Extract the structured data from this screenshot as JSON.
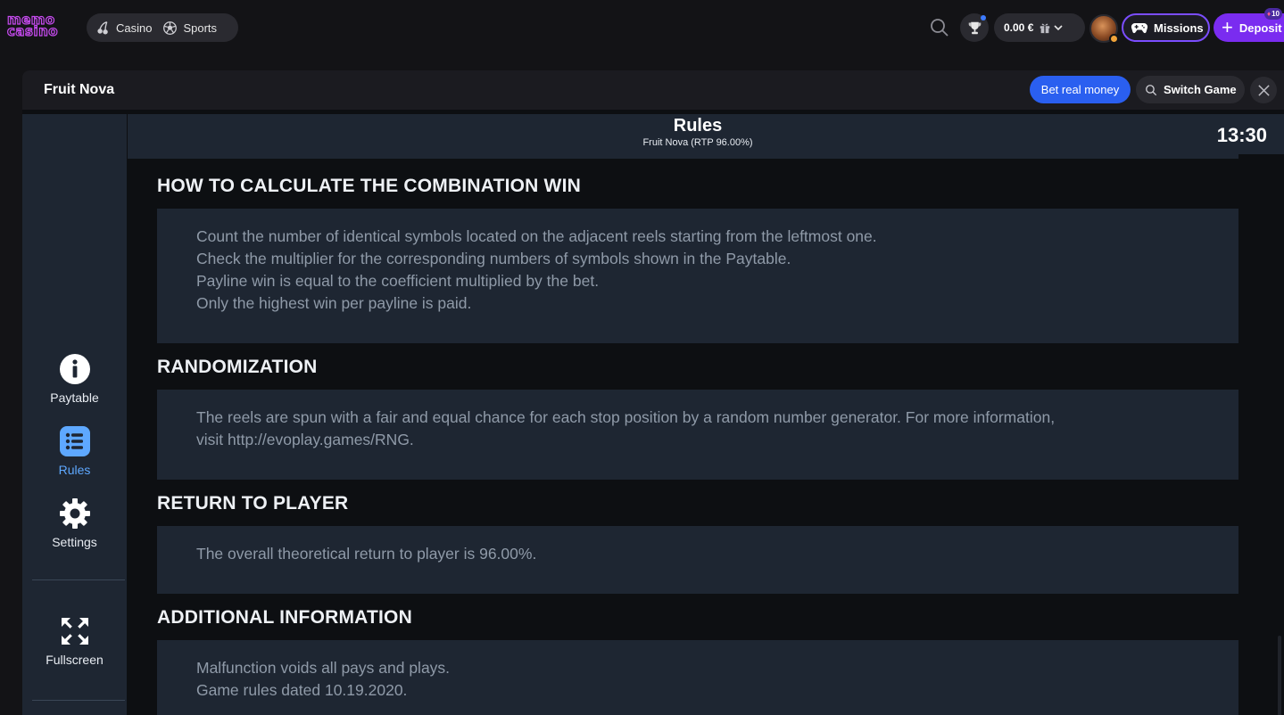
{
  "topbar": {
    "logo_line1": "memo",
    "logo_line2": "casino",
    "nav": [
      {
        "label": "Casino",
        "icon": "cherries-icon"
      },
      {
        "label": "Sports",
        "icon": "soccer-ball-icon"
      }
    ],
    "balance": "0.00 €",
    "missions_label": "Missions",
    "deposit_label": "Deposit",
    "deposit_badge": "10",
    "accent": "#7a2cf0"
  },
  "game": {
    "title": "Fruit Nova",
    "bet_real_label": "Bet real money",
    "switch_game_label": "Switch Game"
  },
  "side_menu": {
    "items": [
      {
        "label": "Paytable",
        "icon": "info-icon"
      },
      {
        "label": "Rules",
        "icon": "list-icon",
        "active": true
      },
      {
        "label": "Settings",
        "icon": "gear-icon"
      },
      {
        "label": "Fullscreen",
        "icon": "fullscreen-icon"
      }
    ],
    "active_color": "#5ea8ff"
  },
  "rules": {
    "title": "Rules",
    "subtitle": "Fruit Nova (RTP 96.00%)",
    "time": "13:30",
    "sections": [
      {
        "title": "HOW TO CALCULATE THE COMBINATION WIN",
        "lines": [
          "Count the number of identical symbols located on the adjacent reels starting from the leftmost one.",
          "Check the multiplier for the corresponding numbers of symbols shown in the Paytable.",
          "Payline win is equal to the coefficient multiplied by the bet.",
          "Only the highest win per payline is paid."
        ]
      },
      {
        "title": "RANDOMIZATION",
        "lines": [
          "The reels are spun with a fair and equal chance for each stop position by a random number generator. For more information,",
          "visit http://evoplay.games/RNG."
        ]
      },
      {
        "title": "RETURN TO PLAYER",
        "lines": [
          "The overall theoretical return to player is 96.00%."
        ]
      },
      {
        "title": "ADDITIONAL INFORMATION",
        "lines": [
          "Malfunction voids all pays and plays.",
          "Game rules dated 10.19.2020."
        ]
      }
    ]
  }
}
